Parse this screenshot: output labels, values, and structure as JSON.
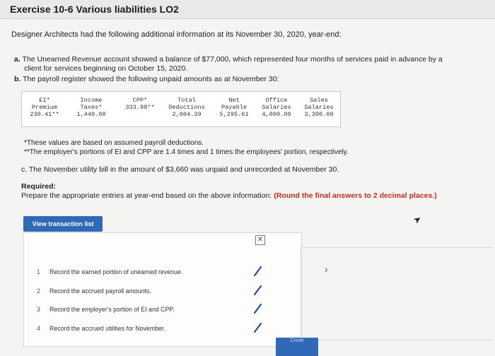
{
  "header": {
    "title": "Exercise 10-6 Various liabilities LO2"
  },
  "intro": "Designer Architects had the following additional information at its November 30, 2020, year-end:",
  "item_a": {
    "tag": "a.",
    "text": "The Unearned Revenue account showed a balance of $77,000, which represented four months of services paid in advance by a",
    "cont": "client for services beginning on October 15, 2020."
  },
  "item_b": {
    "tag": "b.",
    "text": "The payroll register showed the following unpaid amounts as at November 30:"
  },
  "payroll_table": {
    "columns": [
      {
        "h1": "EI*",
        "h2": "Premium",
        "val": "230.41**"
      },
      {
        "h1": "Income",
        "h2": "Taxes*",
        "val": "1,440.00"
      },
      {
        "h1": "",
        "h2": "CPP*",
        "val": "333.98**"
      },
      {
        "h1": "Total",
        "h2": "Deductions",
        "val": "2,004.39"
      },
      {
        "h1": "Net",
        "h2": "Payable",
        "val": "5,295.61"
      },
      {
        "h1": "Office",
        "h2": "Salaries",
        "val": "4,000.00"
      },
      {
        "h1": "Sales",
        "h2": "Salaries",
        "val": "3,300.00"
      }
    ]
  },
  "footnotes": {
    "f1": "*These values are based on assumed payroll deductions.",
    "f2": "**The employer's portions of EI and CPP are 1.4 times and 1 times the employees' portion, respectively."
  },
  "item_c": "c. The November utility bill in the amount of $3,660 was unpaid and unrecorded at November 30.",
  "required": {
    "label": "Required:",
    "text": "Prepare the appropriate entries at year-end based on the above information:",
    "note": "(Round the final answers to 2 decimal places.)"
  },
  "view_button": "View transaction list",
  "transactions": [
    {
      "num": "1",
      "text": "Record the earned portion of unearned revenue."
    },
    {
      "num": "2",
      "text": "Record the accrued payroll amounts."
    },
    {
      "num": "3",
      "text": "Record the employer's portion of EI and CPP."
    },
    {
      "num": "4",
      "text": "Record the accrued utilities for November."
    }
  ],
  "credit_tab": "Credit",
  "colors": {
    "accent": "#2f69b8",
    "note_red": "#c0301e",
    "check": "#1f4f9c"
  },
  "icons": {
    "close": "close-icon",
    "next": "chevron-right-icon",
    "check": "check-icon"
  }
}
